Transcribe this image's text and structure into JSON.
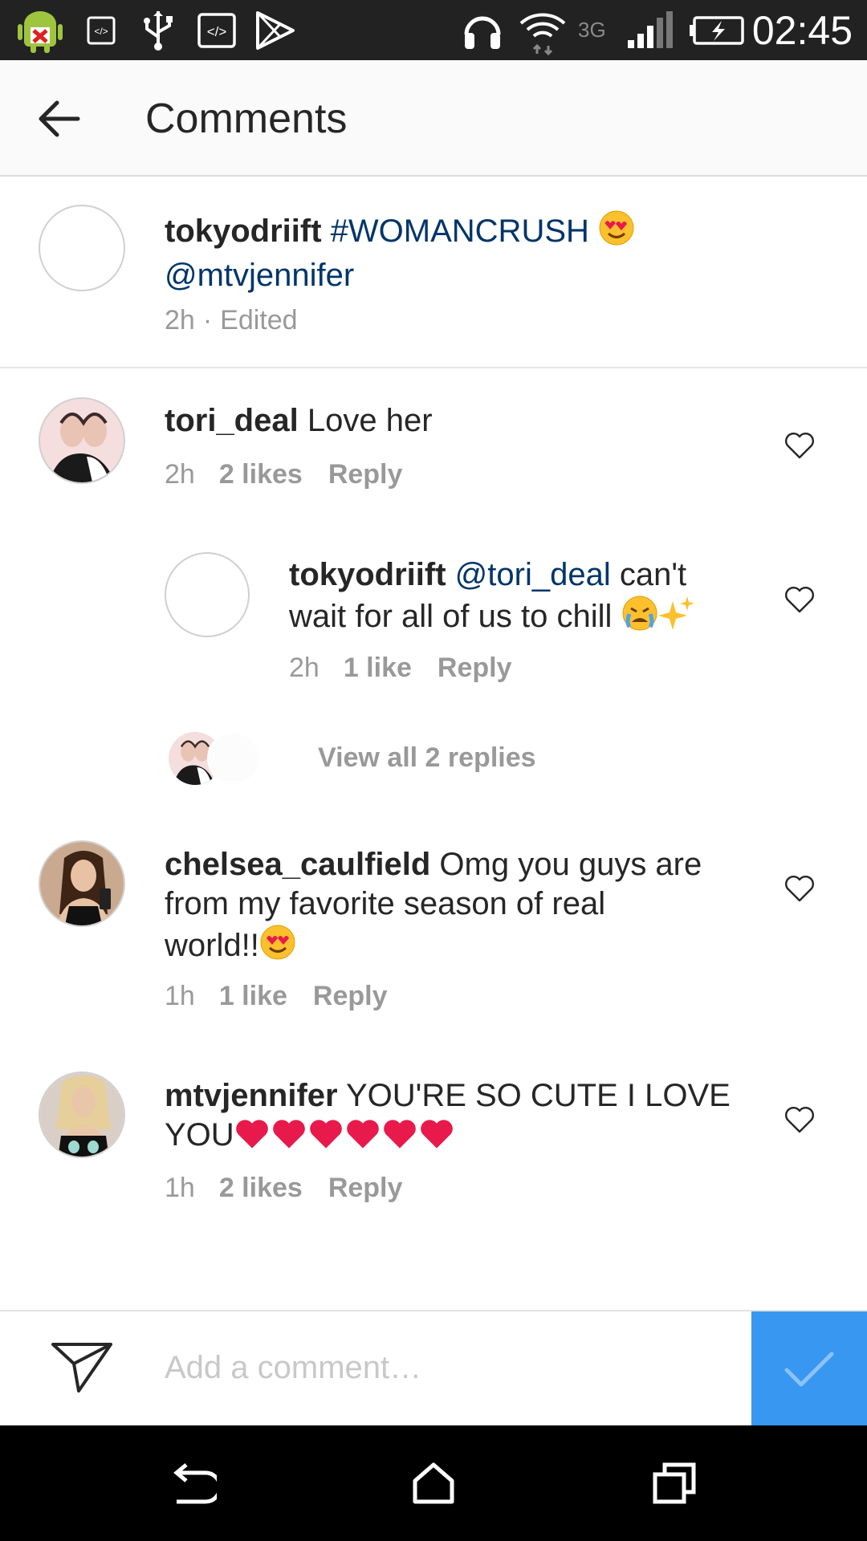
{
  "status_bar": {
    "time": "02:45",
    "network": "3G",
    "icons": [
      "android-debug-icon",
      "code-icon",
      "usb-icon",
      "code-box-icon",
      "play-store-icon",
      "headset-icon",
      "wifi-icon",
      "signal-icon",
      "battery-charging-icon"
    ]
  },
  "header": {
    "title": "Comments",
    "back_icon": "arrow-left-icon"
  },
  "caption": {
    "username": "tokyodriift",
    "hashtag": "#WOMANCRUSH",
    "mention": "@mtvjennifer",
    "emoji": "heart-eyes-emoji",
    "time": "2h",
    "edited": "Edited",
    "separator": "·"
  },
  "comments": [
    {
      "username": "tori_deal",
      "text": "Love her",
      "time": "2h",
      "likes": "2 likes",
      "reply": "Reply"
    },
    {
      "username": "tokyodriift",
      "mention": "@tori_deal",
      "text_line1": "can't",
      "text_line2": "wait for all of us to chill",
      "emojis": [
        "crying-emoji",
        "sparkles-emoji"
      ],
      "time": "2h",
      "likes": "1 like",
      "reply": "Reply"
    },
    {
      "username": "chelsea_caulfield",
      "text_line1": "Omg you guys are",
      "text_line2": "from my favorite season of real",
      "text_line3": "world!!",
      "emoji": "heart-eyes-emoji",
      "time": "1h",
      "likes": "1 like",
      "reply": "Reply"
    },
    {
      "username": "mtvjennifer",
      "text_line1": "YOU'RE SO CUTE I LOVE",
      "text_line2": "YOU",
      "hearts": 6,
      "time": "1h",
      "likes": "2 likes",
      "reply": "Reply"
    }
  ],
  "view_replies": "View all 2 replies",
  "compose": {
    "placeholder": "Add a comment…"
  },
  "colors": {
    "link": "#003569",
    "accent": "#3897f0",
    "meta": "#999999",
    "heart_red": "#e8194b"
  }
}
